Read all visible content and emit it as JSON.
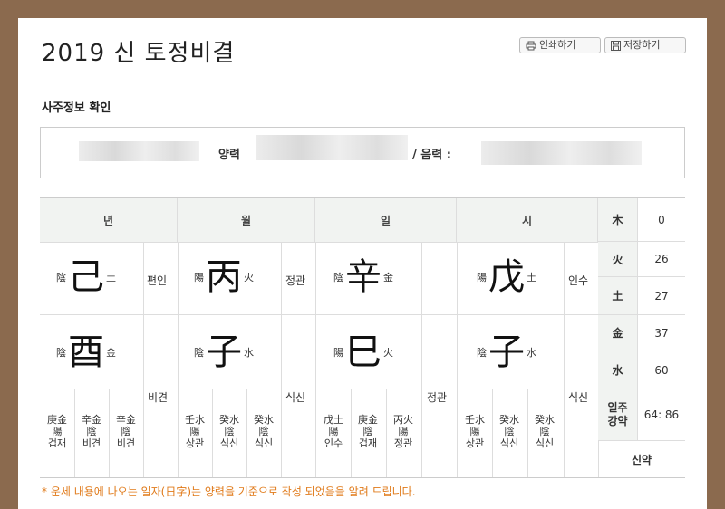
{
  "header": {
    "title": "2019 신 토정비결",
    "print_label": "인쇄하기",
    "save_label": "저장하기"
  },
  "section": {
    "title": "사주정보 확인"
  },
  "info": {
    "solar_label": "양력",
    "lunar_label": "/ 음력 :"
  },
  "columns": [
    {
      "label": "년"
    },
    {
      "label": "월"
    },
    {
      "label": "일"
    },
    {
      "label": "시"
    }
  ],
  "pillars": {
    "year": {
      "stem": {
        "yy": "陰",
        "char": "己",
        "el": "土"
      },
      "stem_ss": "편인",
      "branch": {
        "yy": "陰",
        "char": "酉",
        "el": "金"
      },
      "branch_ss": "비견",
      "hidden": [
        {
          "t": "庚金\n陽\n겁재"
        },
        {
          "t": "辛金\n陰\n비견"
        },
        {
          "t": "辛金\n陰\n비견"
        }
      ]
    },
    "month": {
      "stem": {
        "yy": "陽",
        "char": "丙",
        "el": "火"
      },
      "stem_ss": "정관",
      "branch": {
        "yy": "陰",
        "char": "子",
        "el": "水"
      },
      "branch_ss": "식신",
      "hidden": [
        {
          "t": "壬水\n陽\n상관"
        },
        {
          "t": "癸水\n陰\n식신"
        },
        {
          "t": "癸水\n陰\n식신"
        }
      ]
    },
    "day": {
      "stem": {
        "yy": "陰",
        "char": "辛",
        "el": "金"
      },
      "stem_ss": "",
      "branch": {
        "yy": "陽",
        "char": "巳",
        "el": "火"
      },
      "branch_ss": "정관",
      "hidden": [
        {
          "t": "戊土\n陽\n인수"
        },
        {
          "t": "庚金\n陰\n겁재"
        },
        {
          "t": "丙火\n陽\n정관"
        }
      ]
    },
    "hour": {
      "stem": {
        "yy": "陽",
        "char": "戊",
        "el": "土"
      },
      "stem_ss": "인수",
      "branch": {
        "yy": "陰",
        "char": "子",
        "el": "水"
      },
      "branch_ss": "식신",
      "hidden": [
        {
          "t": "壬水\n陽\n상관"
        },
        {
          "t": "癸水\n陰\n식신"
        },
        {
          "t": "癸水\n陰\n식신"
        }
      ]
    }
  },
  "elements": [
    {
      "name": "木",
      "value": "0"
    },
    {
      "name": "火",
      "value": "26"
    },
    {
      "name": "土",
      "value": "27"
    },
    {
      "name": "金",
      "value": "37"
    },
    {
      "name": "水",
      "value": "60"
    }
  ],
  "strength": {
    "label": "일주\n강약",
    "value": "64: 86",
    "result": "신약"
  },
  "note": "* 운세 내용에 나오는 일자(日字)는 양력을 기준으로 작성 되었음을 알려 드립니다.",
  "colors": {
    "frame": "#8b6a4e",
    "header_bg": "#f1f3f1",
    "note": "#e07a1a"
  }
}
